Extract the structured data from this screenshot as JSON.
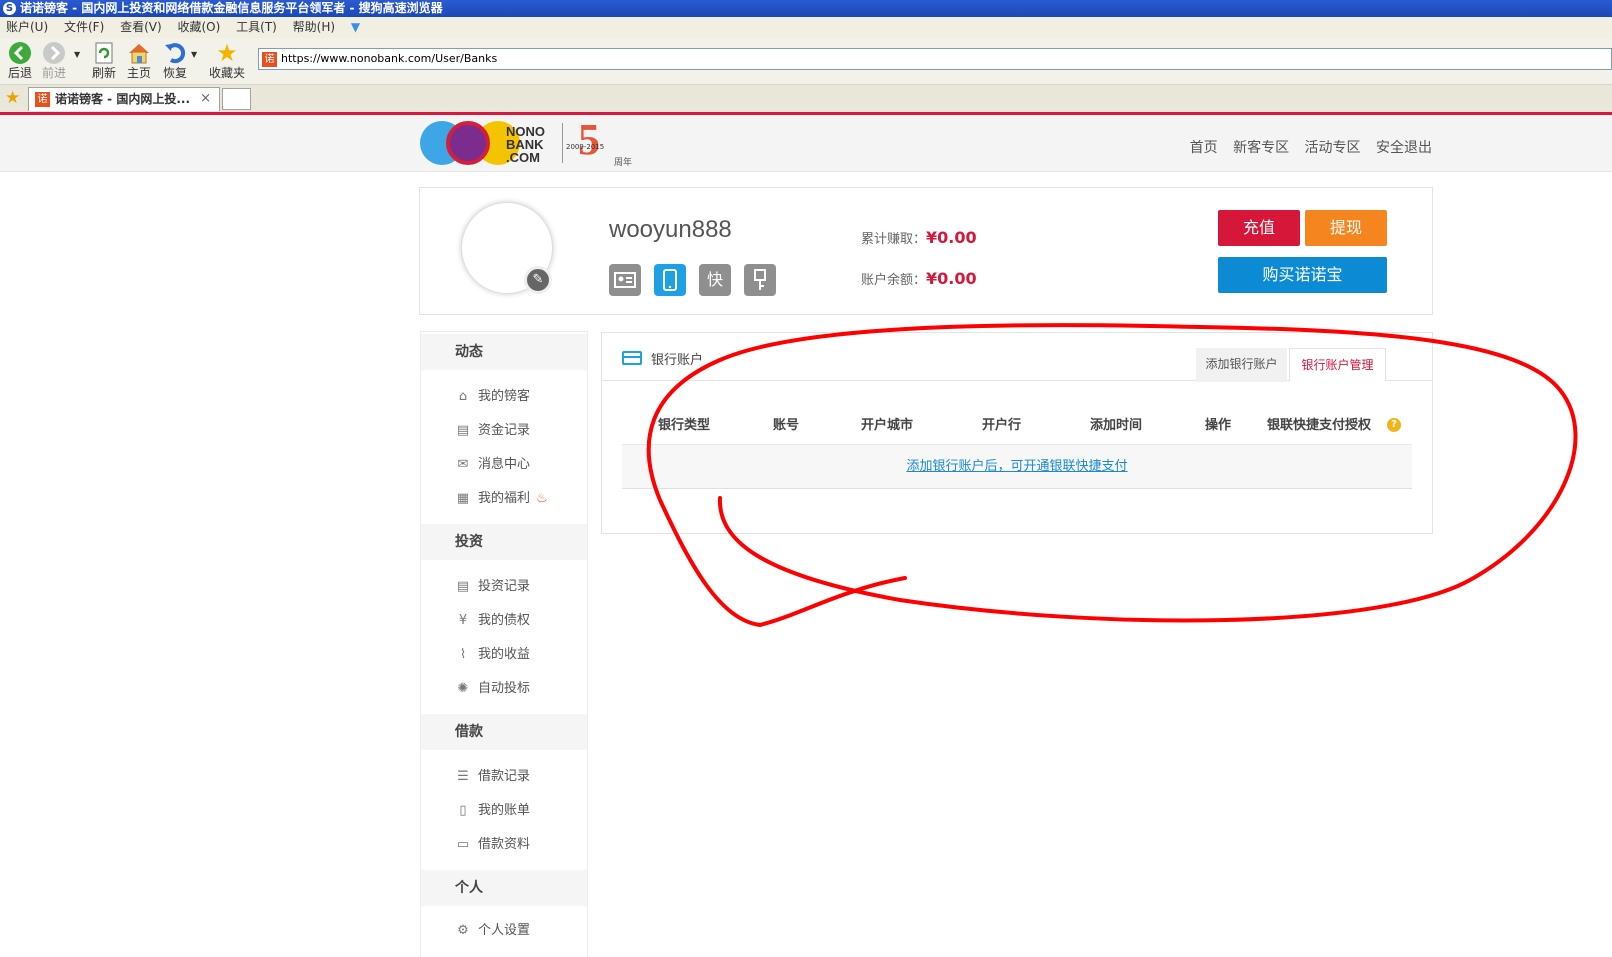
{
  "browser": {
    "window_title": "诺诺镑客 - 国内网上投资和网络借款金融信息服务平台领军者 - 搜狗高速浏览器",
    "menu": [
      "账户(U)",
      "文件(F)",
      "查看(V)",
      "收藏(O)",
      "工具(T)",
      "帮助(H)"
    ],
    "toolbar": {
      "back": "后退",
      "forward": "前进",
      "refresh": "刷新",
      "home": "主页",
      "restore": "恢复",
      "favorites": "收藏夹"
    },
    "address_url": "https://www.nonobank.com/User/Banks",
    "tab_title": "诺诺镑客 - 国内网上投...",
    "tab_close": "×",
    "favicon_glyph": "诺"
  },
  "site": {
    "brand_top": "NONO",
    "brand_mid": "BANK",
    "brand_bottom": ".COM",
    "anniversary_number": "5",
    "anniversary_years": "2009-2015",
    "anniversary_label": "周年",
    "nav": [
      "首页",
      "新客专区",
      "活动专区",
      "安全退出"
    ],
    "accent_red": "#d6173a",
    "accent_orange": "#f5861f",
    "accent_blue": "#0c8ad4"
  },
  "profile": {
    "username": "wooyun888",
    "earned_label": "累计赚取：",
    "earned_value": "¥0.00",
    "balance_label": "账户余额：",
    "balance_value": "¥0.00",
    "verify_quick_label": "快",
    "buttons": {
      "recharge": "充值",
      "withdraw": "提现",
      "buy": "购买诺诺宝"
    }
  },
  "sidebar": {
    "sections": [
      {
        "title": "动态",
        "items": [
          "我的镑客",
          "资金记录",
          "消息中心",
          "我的福利"
        ]
      },
      {
        "title": "投资",
        "items": [
          "投资记录",
          "我的债权",
          "我的收益",
          "自动投标"
        ]
      },
      {
        "title": "借款",
        "items": [
          "借款记录",
          "我的账单",
          "借款资料"
        ]
      },
      {
        "title": "个人",
        "items": [
          "个人设置"
        ]
      }
    ]
  },
  "panel": {
    "title": "银行账户",
    "tabs": [
      "添加银行账户",
      "银行账户管理"
    ],
    "active_tab": "银行账户管理",
    "columns": [
      "银行类型",
      "账号",
      "开户城市",
      "开户行",
      "添加时间",
      "操作",
      "银联快捷支付授权"
    ],
    "help_icon_glyph": "?",
    "empty_message": "添加银行账户后，可开通银联快捷支付"
  }
}
